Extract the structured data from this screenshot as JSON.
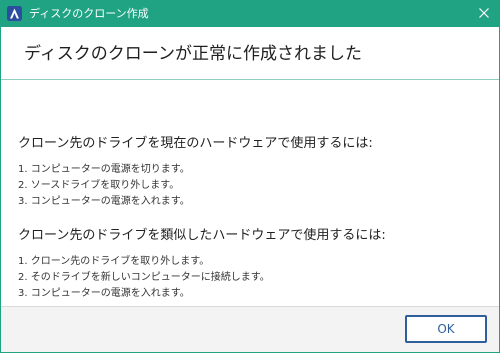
{
  "window": {
    "title": "ディスクのクローン作成",
    "close_icon": "close-icon",
    "app_icon": "app-logo-icon",
    "accent_color": "#1fa383"
  },
  "header": {
    "title": "ディスクのクローンが正常に作成されました"
  },
  "sections": [
    {
      "heading": "クローン先のドライブを現在のハードウェアで使用するには:",
      "steps": [
        "1. コンピューターの電源を切ります。",
        "2. ソースドライブを取り外します。",
        "3. コンピューターの電源を入れます。"
      ]
    },
    {
      "heading": "クローン先のドライブを類似したハードウェアで使用するには:",
      "steps": [
        "1. クローン先のドライブを取り外します。",
        "2. そのドライブを新しいコンピューターに接続します。",
        "3. コンピューターの電源を入れます。"
      ]
    }
  ],
  "footer": {
    "ok_label": "OK"
  }
}
